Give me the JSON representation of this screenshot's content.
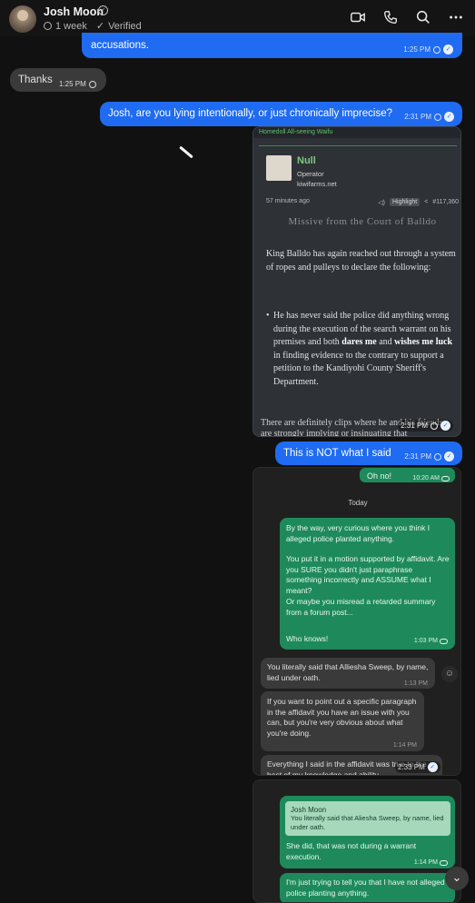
{
  "header": {
    "name": "Josh Moon",
    "last_seen": "1 week",
    "verified": "Verified",
    "icons": [
      "video-icon",
      "phone-icon",
      "search-icon",
      "more-icon"
    ]
  },
  "messages": {
    "m1_text": "accusations.",
    "m1_time": "1:25 PM",
    "m2_text": "Thanks",
    "m2_time": "1:25 PM",
    "m3_text": "Josh, are you lying intentionally, or just chronically imprecise?",
    "m3_time": "2:31 PM",
    "m4_time": "2:31 PM",
    "m5_text": "This is NOT what I said",
    "m5_time": "2:31 PM",
    "m6_time": "2:33 PM"
  },
  "forum_shot": {
    "top": "Homedoll All-seeing Waifu",
    "name": "Null",
    "role": "Operator",
    "site": "kiwifarms.net",
    "time_ago": "57 minutes ago",
    "highlight": "Highlight",
    "post_no": "#117,360",
    "heading": "Missive from the Court of Balldo",
    "body": "King Balldo has again reached out through a system of ropes and pulleys to declare the following:",
    "li_a": "He has never said the police did anything wrong during the execution of the search warrant on his premises and both ",
    "li_b1": "dares me",
    "li_c": " and ",
    "li_b2": "wishes me luck",
    "li_d": " in finding evidence to the contrary to support a petition to the Kandiyohi County Sheriff's Department.",
    "bottom": "There are definitely clips where he and his friends are strongly implying or insinuating that"
  },
  "phone_shot": {
    "oh_no": "Oh no!",
    "oh_no_time": "10:20 AM",
    "today": "Today",
    "g1": "By the way, very curious where you think I alleged police planted anything.",
    "g2": "You put it in a motion supported by affidavit.  Are you SURE you didn't just paraphrase something incorrectly and ASSUME what I meant?",
    "g3": "Or maybe you misread a retarded summary from a forum post...",
    "g4": "Who knows!",
    "g_time": "1:03 PM",
    "r1": "You literally said that Alliesha Sweep, by name, lied under oath.",
    "r1_time": "1:13 PM",
    "r2": "If you want to point out a specific paragraph in the affidavit you have an issue with you can, but you're very obvious about what you're doing.",
    "r2_time": "1:14 PM",
    "r3": "Everything I said in the affidavit was true to the best of my knowledge and ability.",
    "quote_name": "Josh Moon",
    "quote_text": "You literally said that Aliesha Sweep, by name, lied under oath.",
    "reply1": "She did, that was not during a warrant execution.",
    "reply1_time": "1:14 PM",
    "reply2": "I'm just trying to tell you that I have not alleged police planting anything."
  }
}
